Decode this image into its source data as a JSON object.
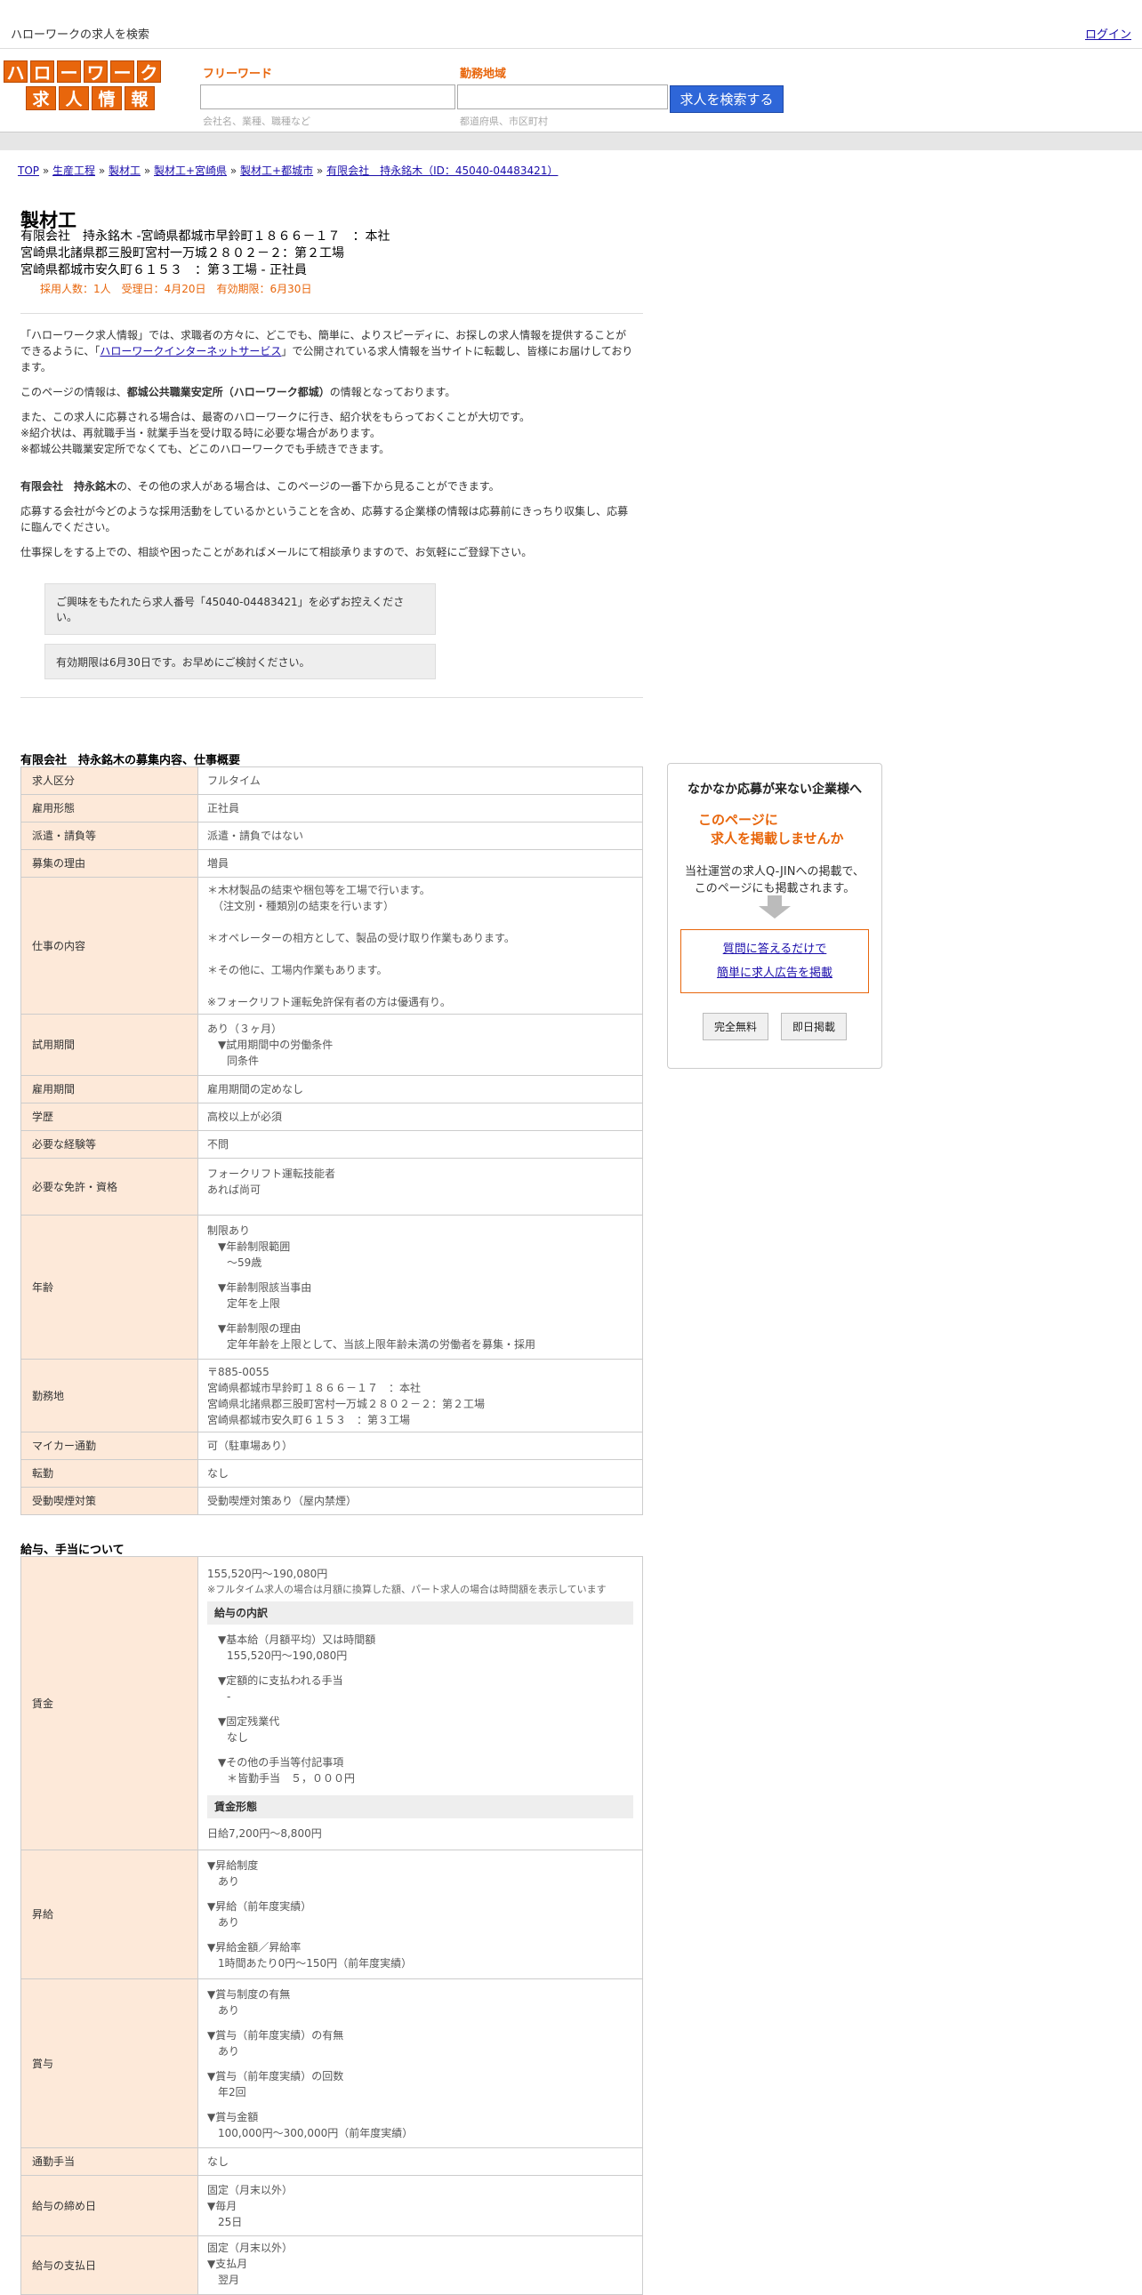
{
  "header": {
    "site_title": "ハローワークの求人を検索",
    "login": "ログイン"
  },
  "logo": {
    "row1": [
      "ハ",
      "ロ",
      "ー",
      "ワ",
      "ー",
      "ク"
    ],
    "row2": [
      "求",
      "人",
      "情",
      "報"
    ]
  },
  "search": {
    "keyword_label": "フリーワード",
    "keyword_placeholder": "会社名、業種、職種など",
    "area_label": "勤務地域",
    "area_placeholder": "都道府県、市区町村",
    "button": "求人を検索する"
  },
  "breadcrumb": [
    "TOP",
    "生産工程",
    "製材工",
    "製材工+宮崎県",
    "製材工+都城市",
    "有限会社　持永銘木（ID：45040-04483421）"
  ],
  "job": {
    "title": "製材工",
    "company_lines": [
      "有限会社　持永銘木 -宮崎県都城市早鈴町１８６６－１７　：本社",
      "宮崎県北諸県郡三股町宮村一万城２８０２－２：第２工場",
      "宮崎県都城市安久町６１５３　：第３工場 - 正社員"
    ],
    "meta": "採用人数：1人　受理日：4月20日　有効期限：6月30日"
  },
  "intro": {
    "p1a": "「ハローワーク求人情報」では、求職者の方々に、どこでも、簡単に、よりスピーディに、お探しの求人情報を提供することができるように、「",
    "p1_link": "ハローワークインターネットサービス",
    "p1b": "」で公開されている求人情報を当サイトに転載し、皆様にお届けしております。",
    "p2a": "このページの情報は、",
    "p2_bold": "都城公共職業安定所（ハローワーク都城）",
    "p2b": "の情報となっております。",
    "p3": "また、この求人に応募される場合は、最寄のハローワークに行き、紹介状をもらっておくことが大切です。",
    "p4": "※紹介状は、再就職手当・就業手当を受け取る時に必要な場合があります。",
    "p5": "※都城公共職業安定所でなくても、どこのハローワークでも手続きできます。",
    "p6_bold": "有限会社　持永銘木",
    "p6": "の、その他の求人がある場合は、このページの一番下から見ることができます。",
    "p7": "応募する会社が今どのような採用活動をしているかということを含め、応募する企業様の情報は応募前にきっちり収集し、応募に臨んでください。",
    "p8": "仕事探しをする上での、相談や困ったことがあればメールにて相談承りますので、お気軽にご登録下さい。"
  },
  "notices": {
    "n1": "ご興味をもたれたら求人番号「45040-04483421」を必ずお控えください。",
    "n2": "有効期限は6月30日です。お早めにご検討ください。"
  },
  "section1": {
    "title": "有限会社　持永銘木の募集内容、仕事概要",
    "rows": {
      "kubun": {
        "label": "求人区分",
        "value": "フルタイム"
      },
      "koyou": {
        "label": "雇用形態",
        "value": "正社員"
      },
      "haken": {
        "label": "派遣・請負等",
        "value": "派遣・請負ではない"
      },
      "riyuu": {
        "label": "募集の理由",
        "value": "増員"
      },
      "shigoto": {
        "label": "仕事の内容",
        "lines": [
          "＊木材製品の結束や梱包等を工場で行います。",
          "　（注文別・種類別の結束を行います）",
          "＊オペレーターの相方として、製品の受け取り作業もあります。",
          "＊その他に、工場内作業もあります。",
          "※フォークリフト運転免許保有者の方は優遇有り。"
        ]
      },
      "shiyou": {
        "label": "試用期間",
        "l1": "あり（３ヶ月）",
        "l2": "▼試用期間中の労働条件",
        "l3": "同条件"
      },
      "koyoukikan": {
        "label": "雇用期間",
        "value": "雇用期間の定めなし"
      },
      "gakureki": {
        "label": "学歴",
        "value": "高校以上が必須"
      },
      "keiken": {
        "label": "必要な経験等",
        "value": "不問"
      },
      "menkyo": {
        "label": "必要な免許・資格",
        "l1": "フォークリフト運転技能者",
        "l2": "あれば尚可"
      },
      "nenrei": {
        "label": "年齢",
        "l1": "制限あり",
        "h1": "▼年齢制限範囲",
        "v1": "〜59歳",
        "h2": "▼年齢制限該当事由",
        "v2": "定年を上限",
        "h3": "▼年齢制限の理由",
        "v3": "定年年齢を上限として、当該上限年齢未満の労働者を募集・採用"
      },
      "kinmuchi": {
        "label": "勤務地",
        "lines": [
          "〒885-0055",
          "宮崎県都城市早鈴町１８６６－１７　：本社",
          "宮崎県北諸県郡三股町宮村一万城２８０２－２：第２工場",
          "宮崎県都城市安久町６１５３　：第３工場"
        ]
      },
      "mycar": {
        "label": "マイカー通勤",
        "value": "可（駐車場あり）"
      },
      "tenkin": {
        "label": "転勤",
        "value": "なし"
      },
      "judou": {
        "label": "受動喫煙対策",
        "value": "受動喫煙対策あり（屋内禁煙）"
      }
    }
  },
  "section2": {
    "title": "給与、手当について",
    "chingin": {
      "label": "賃金",
      "range": "155,520円〜190,080円",
      "note": "※フルタイム求人の場合は月額に換算した額、パート求人の場合は時間額を表示しています",
      "breakdown_head": "給与の内訳",
      "b1h": "▼基本給（月額平均）又は時間額",
      "b1v": "155,520円〜190,080円",
      "b2h": "▼定額的に支払われる手当",
      "b2v": "-",
      "b3h": "▼固定残業代",
      "b3v": "なし",
      "b4h": "▼その他の手当等付記事項",
      "b4v": "＊皆勤手当　５，０００円",
      "form_head": "賃金形態",
      "form_value": "日給7,200円〜8,800円"
    },
    "shoukyu": {
      "label": "昇給",
      "h1": "▼昇給制度",
      "v1": "あり",
      "h2": "▼昇給（前年度実績）",
      "v2": "あり",
      "h3": "▼昇給金額／昇給率",
      "v3": "1時間あたり0円〜150円（前年度実績）"
    },
    "shouyo": {
      "label": "賞与",
      "h1": "▼賞与制度の有無",
      "v1": "あり",
      "h2": "▼賞与（前年度実績）の有無",
      "v2": "あり",
      "h3": "▼賞与（前年度実績）の回数",
      "v3": "年2回",
      "h4": "▼賞与金額",
      "v4": "100,000円〜300,000円（前年度実績）"
    },
    "tsukin": {
      "label": "通勤手当",
      "value": "なし"
    },
    "shimebi": {
      "label": "給与の締め日",
      "l1": "固定（月末以外）",
      "l2": "▼毎月",
      "l3": "25日"
    },
    "shiharai": {
      "label": "給与の支払日",
      "l1": "固定（月末以外）",
      "l2": "▼支払月",
      "l3": "翌月"
    }
  },
  "sidebar": {
    "title": "なかなか応募が来ない企業様へ",
    "offer1": "このページに",
    "offer2": "求人を掲載しませんか",
    "desc1": "当社運営の求人Q-JINへの掲載で、",
    "desc2": "このページにも掲載されます。",
    "link1": "質問に答えるだけで",
    "link2": "簡単に求人広告を掲載",
    "btn1": "完全無料",
    "btn2": "即日掲載"
  }
}
